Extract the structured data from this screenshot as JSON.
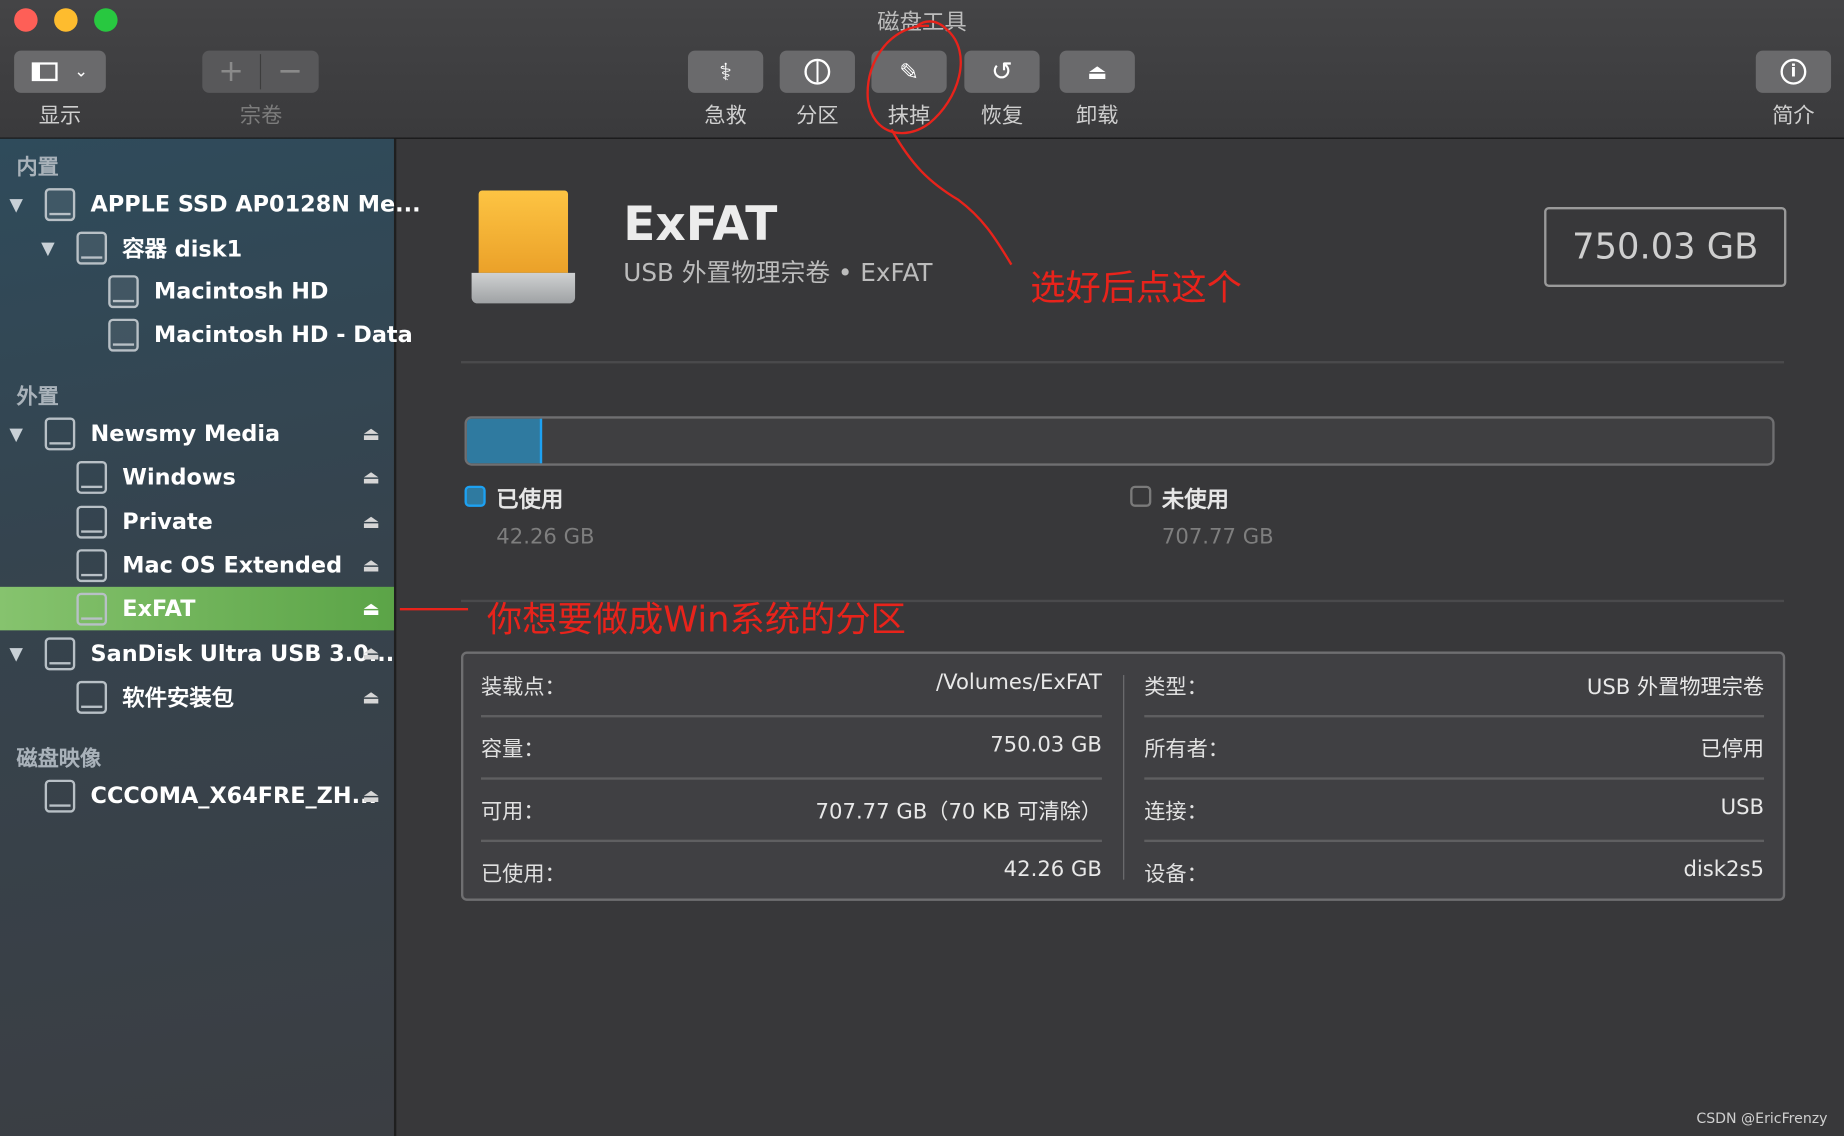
{
  "window": {
    "title": "磁盘工具"
  },
  "toolbar": {
    "view": {
      "label": "显示",
      "icon": "sidebar-toggle-icon"
    },
    "volume": {
      "label": "宗卷",
      "add": "+",
      "remove": "−"
    },
    "first_aid": {
      "label": "急救",
      "icon": "stethoscope-icon"
    },
    "partition": {
      "label": "分区",
      "icon": "pie-icon"
    },
    "erase": {
      "label": "抹掉",
      "icon": "erase-icon"
    },
    "restore": {
      "label": "恢复",
      "icon": "restore-icon"
    },
    "unmount": {
      "label": "卸载",
      "icon": "unmount-icon"
    },
    "info": {
      "label": "简介",
      "icon": "info-icon"
    }
  },
  "sidebar": {
    "sections": [
      {
        "title": "内置"
      },
      {
        "title": "外置"
      },
      {
        "title": "磁盘映像"
      }
    ],
    "items": [
      {
        "label": "APPLE SSD AP0128N Me..."
      },
      {
        "label": "容器 disk1"
      },
      {
        "label": "Macintosh HD"
      },
      {
        "label": "Macintosh HD - Data"
      },
      {
        "label": "Newsmy Media"
      },
      {
        "label": "Windows"
      },
      {
        "label": "Private"
      },
      {
        "label": "Mac OS Extended"
      },
      {
        "label": "ExFAT",
        "selected": true
      },
      {
        "label": "SanDisk Ultra USB 3.0..."
      },
      {
        "label": "软件安装包"
      },
      {
        "label": "CCCOMA_X64FRE_ZH..."
      }
    ]
  },
  "volume": {
    "name": "ExFAT",
    "subtitle": "USB 外置物理宗卷 • ExFAT",
    "capacity": "750.03 GB",
    "used_fraction": 0.0563,
    "colors": {
      "used": "#2f7aa0",
      "accent": "#1da1f2"
    },
    "legend": [
      {
        "label": "已使用",
        "value": "42.26 GB"
      },
      {
        "label": "未使用",
        "value": "707.77 GB"
      }
    ]
  },
  "details": {
    "left": [
      {
        "label": "装载点：",
        "value": "/Volumes/ExFAT"
      },
      {
        "label": "容量：",
        "value": "750.03 GB"
      },
      {
        "label": "可用：",
        "value": "707.77 GB（70 KB 可清除）"
      },
      {
        "label": "已使用：",
        "value": "42.26 GB"
      }
    ],
    "right": [
      {
        "label": "类型：",
        "value": "USB 外置物理宗卷"
      },
      {
        "label": "所有者：",
        "value": "已停用"
      },
      {
        "label": "连接：",
        "value": "USB"
      },
      {
        "label": "设备：",
        "value": "disk2s5"
      }
    ]
  },
  "annotations": {
    "erase_hint": "选好后点这个",
    "select_hint": "你想要做成Win系统的分区",
    "color": "#e8231b"
  },
  "watermark": "CSDN @EricFrenzy"
}
